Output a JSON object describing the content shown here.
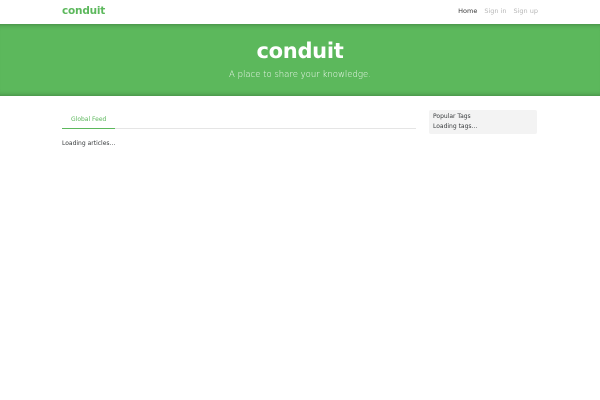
{
  "navbar": {
    "brand": "conduit",
    "links": [
      {
        "label": "Home",
        "active": true
      },
      {
        "label": "Sign in",
        "active": false
      },
      {
        "label": "Sign up",
        "active": false
      }
    ]
  },
  "banner": {
    "title": "conduit",
    "subtitle": "A place to share your knowledge."
  },
  "feed": {
    "tabs": [
      {
        "label": "Global Feed",
        "active": true
      }
    ],
    "status": "Loading articles..."
  },
  "sidebar": {
    "title": "Popular Tags",
    "status": "Loading tags..."
  },
  "colors": {
    "brand": "#5cb85c",
    "text": "#373a3c",
    "sidebar_bg": "#f3f3f3"
  }
}
